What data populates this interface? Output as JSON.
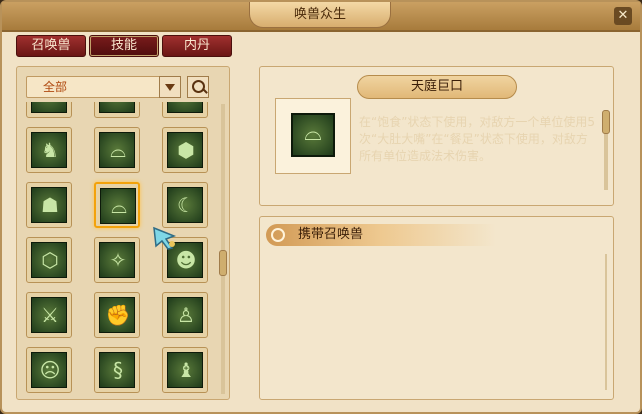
{
  "window": {
    "title": "唤兽众生"
  },
  "tabs": [
    {
      "label": "召唤兽"
    },
    {
      "label": "技能"
    },
    {
      "label": "内丹"
    }
  ],
  "filter": {
    "selected": "全部"
  },
  "skill_grid": [
    {
      "icon": "waves-icon"
    },
    {
      "icon": "flame-icon"
    },
    {
      "icon": "claw-icon"
    },
    {
      "icon": "dragon-icon"
    },
    {
      "icon": "bowl-icon"
    },
    {
      "icon": "talisman-icon"
    },
    {
      "icon": "beast-icon"
    },
    {
      "icon": "bowl-icon",
      "selected": true
    },
    {
      "icon": "moon-icon"
    },
    {
      "icon": "cube-icon"
    },
    {
      "icon": "star-moon-icon"
    },
    {
      "icon": "mask-icon"
    },
    {
      "icon": "weapon-icon"
    },
    {
      "icon": "fist-icon"
    },
    {
      "icon": "spirit-icon"
    },
    {
      "icon": "demon-face-icon"
    },
    {
      "icon": "serpent-icon"
    },
    {
      "icon": "dragon-head-icon"
    }
  ],
  "detail": {
    "name": "天庭巨口",
    "icon": "bowl-icon",
    "description": "在“饱食”状态下使用，对敌方一个单位使用5次“大肚大嘴”在“餐足”状态下使用，对敌方所有单位造成法术伤害。"
  },
  "carry_section": {
    "title": "携带召唤兽"
  },
  "colors": {
    "accent": "#f3a20b",
    "tab_bg": "#7a1c1c",
    "panel": "#f3e6cc"
  }
}
